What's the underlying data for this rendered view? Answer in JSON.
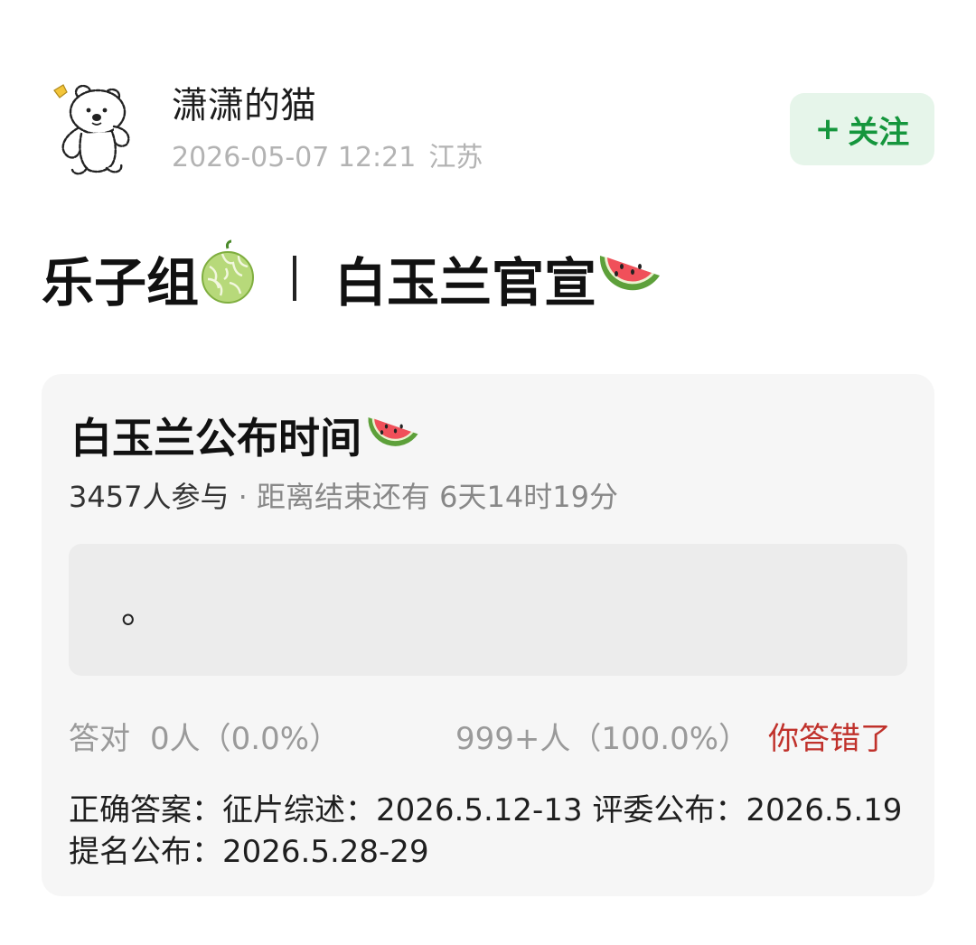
{
  "post": {
    "username": "潇潇的猫",
    "date": "2026-05-07 12:21",
    "location": "江苏",
    "follow_label": "关注",
    "follow_plus": "+",
    "title_left": "乐子组",
    "title_right": "白玉兰官宣"
  },
  "quiz": {
    "title": "白玉兰公布时间",
    "participants": "3457人参与",
    "separator": " · ",
    "remaining": "距离结束还有 6天14时19分",
    "option_text": "。",
    "correct_label": "答对",
    "correct_stats": "0人（0.0%）",
    "wrong_stats": "999+人（100.0%）",
    "result_label": "你答错了",
    "answer_text": "正确答案：征片综述：2026.5.12-13 评委公布：2026.5.19 提名公布：2026.5.28-29"
  },
  "icons": {
    "avatar": "cartoon-bear-avatar",
    "melon": "melon-emoji",
    "watermelon": "watermelon-emoji"
  },
  "colors": {
    "follow_bg": "#e6f5ea",
    "follow_text": "#15963d",
    "wrong_text": "#c0312b",
    "card_bg": "#f6f6f6"
  }
}
